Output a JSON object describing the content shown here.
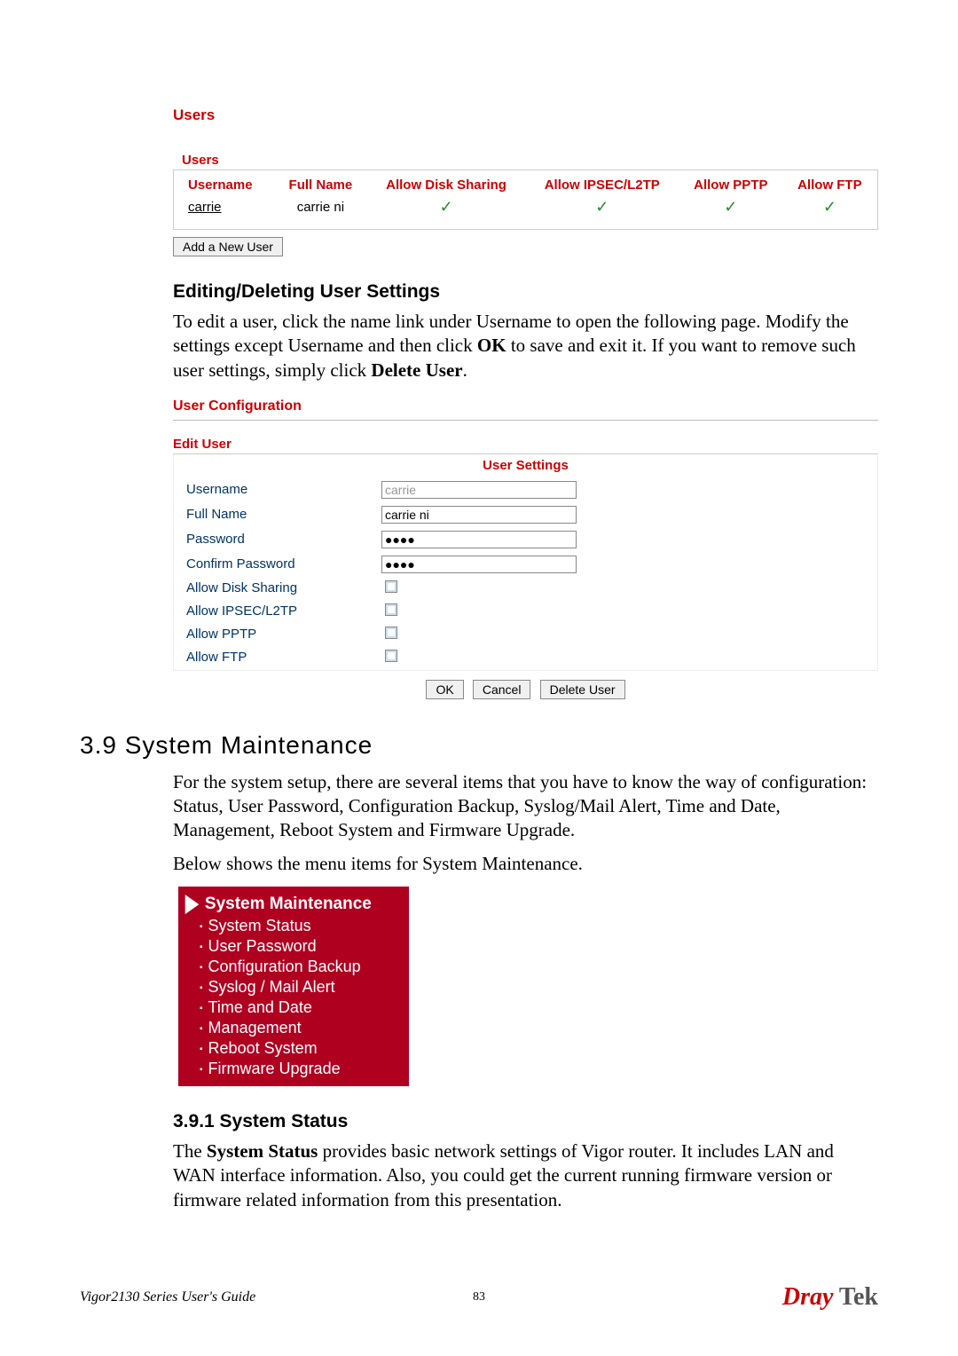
{
  "users_panel": {
    "title": "Users",
    "subtitle": "Users",
    "headers": [
      "Username",
      "Full Name",
      "Allow Disk Sharing",
      "Allow IPSEC/L2TP",
      "Allow PPTP",
      "Allow FTP"
    ],
    "row": {
      "username": "carrie",
      "fullname": "carrie ni"
    },
    "add_btn": "Add a New User"
  },
  "edit_section": {
    "heading": "Editing/Deleting User Settings",
    "para_before_ok": "To edit a user, click the name link under Username to open the following page. Modify the settings except Username and then click ",
    "ok_word": "OK",
    "para_mid": " to save and exit it. If you want to remove such user settings, simply click ",
    "delete_word": "Delete User",
    "para_end": "."
  },
  "user_config": {
    "title": "User Configuration",
    "edit_user": "Edit User",
    "settings_hdr": "User Settings",
    "rows": {
      "username_lbl": "Username",
      "username_val": "carrie",
      "fullname_lbl": "Full Name",
      "fullname_val": "carrie ni",
      "password_lbl": "Password",
      "password_val": "●●●●",
      "confirm_lbl": "Confirm Password",
      "confirm_val": "●●●●",
      "disk_lbl": "Allow Disk Sharing",
      "ipsec_lbl": "Allow IPSEC/L2TP",
      "pptp_lbl": "Allow PPTP",
      "ftp_lbl": "Allow FTP"
    },
    "buttons": {
      "ok": "OK",
      "cancel": "Cancel",
      "delete": "Delete User"
    }
  },
  "sysmaint": {
    "heading": "3.9 System Maintenance",
    "para1": "For the system setup, there are several items that you have to know the way of configuration: Status, User Password, Configuration Backup, Syslog/Mail Alert, Time and Date, Management, Reboot System and Firmware Upgrade.",
    "para2": "Below shows the menu items for System Maintenance.",
    "menu_title": "System Maintenance",
    "menu_items": [
      "System Status",
      "User Password",
      "Configuration Backup",
      "Syslog / Mail Alert",
      "Time and Date",
      "Management",
      "Reboot System",
      "Firmware Upgrade"
    ]
  },
  "sysstatus": {
    "heading": "3.9.1 System Status",
    "para_pre": "The ",
    "para_bold": "System Status",
    "para_post": " provides basic network settings of Vigor router. It includes LAN and WAN interface information. Also, you could get the current running firmware version or firmware related information from this presentation."
  },
  "footer": {
    "guide": "Vigor2130 Series User's Guide",
    "page": "83",
    "brand1": "Dray",
    "brand2": "Tek"
  }
}
